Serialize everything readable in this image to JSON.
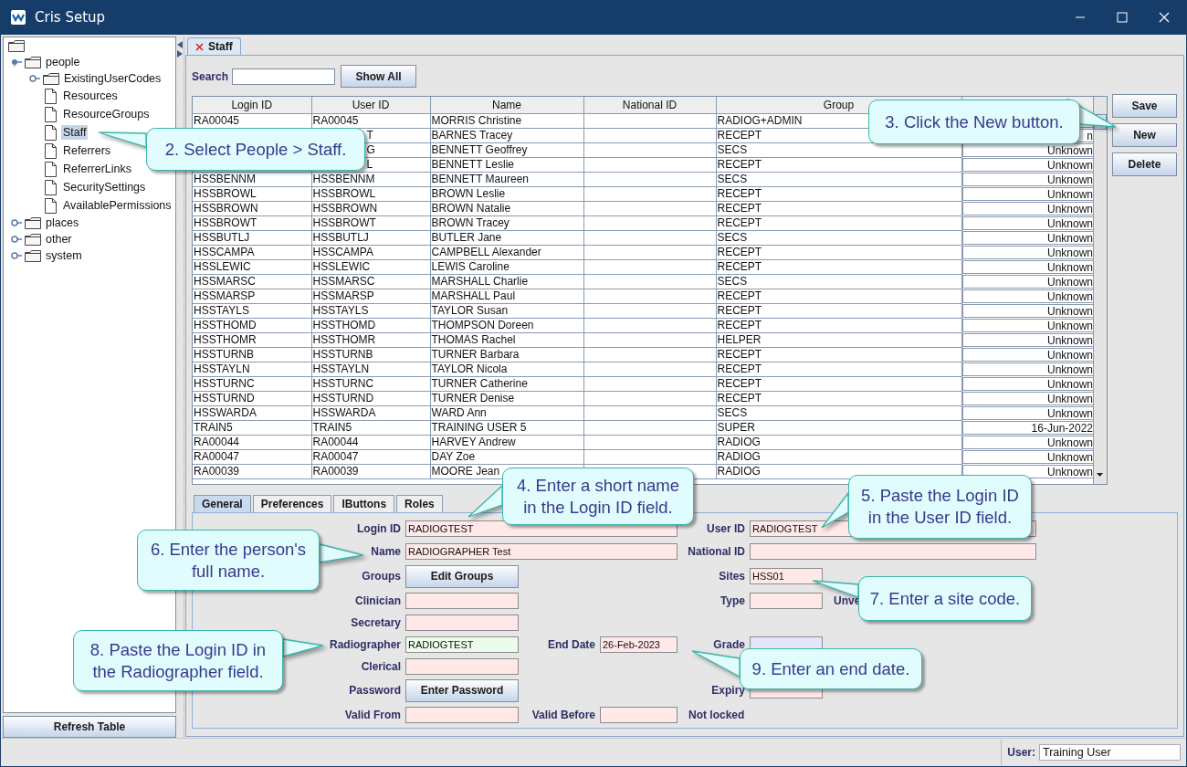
{
  "window": {
    "title": "Cris Setup"
  },
  "tree": {
    "kind": "folder",
    "children": [
      {
        "label": "people",
        "kind": "folder",
        "expanded": true,
        "selected": false,
        "children": [
          {
            "label": "ExistingUserCodes",
            "kind": "folder",
            "expanded": false,
            "selected": false
          },
          {
            "label": "Resources",
            "kind": "page",
            "selected": false
          },
          {
            "label": "ResourceGroups",
            "kind": "page",
            "selected": false
          },
          {
            "label": "Staff",
            "kind": "page",
            "selected": true
          },
          {
            "label": "Referrers",
            "kind": "page",
            "selected": false
          },
          {
            "label": "ReferrerLinks",
            "kind": "page",
            "selected": false
          },
          {
            "label": "SecuritySettings",
            "kind": "page",
            "selected": false
          },
          {
            "label": "AvailablePermissions",
            "kind": "page",
            "selected": false
          }
        ]
      },
      {
        "label": "places",
        "kind": "folder",
        "expanded": false,
        "selected": false
      },
      {
        "label": "other",
        "kind": "folder",
        "expanded": false,
        "selected": false
      },
      {
        "label": "system",
        "kind": "folder",
        "expanded": false,
        "selected": false
      }
    ]
  },
  "refresh_button": "Refresh Table",
  "tab": {
    "label": "Staff"
  },
  "search": {
    "label": "Search",
    "button": "Show All"
  },
  "table": {
    "columns": [
      "Login ID",
      "User ID",
      "Name",
      "National ID",
      "Group",
      null
    ],
    "rows": [
      [
        "RA00045",
        "RA00045",
        "MORRIS Christine",
        null,
        "RADIOG+ADMIN",
        null
      ],
      [
        null,
        {
          "text": "T",
          "covered": true
        },
        "BARNES Tracey",
        null,
        "RECEPT",
        "n"
      ],
      [
        null,
        {
          "text": "G",
          "covered": true
        },
        "BENNETT Geoffrey",
        null,
        "SECS",
        "Unknown"
      ],
      [
        null,
        {
          "text": "L",
          "covered": true
        },
        "BENNETT Leslie",
        null,
        "RECEPT",
        "Unknown"
      ],
      [
        "HSSBENNM",
        "HSSBENNM",
        "BENNETT Maureen",
        null,
        "SECS",
        "Unknown"
      ],
      [
        "HSSBROWL",
        "HSSBROWL",
        "BROWN Leslie",
        null,
        "RECEPT",
        "Unknown"
      ],
      [
        "HSSBROWN",
        "HSSBROWN",
        "BROWN Natalie",
        null,
        "RECEPT",
        "Unknown"
      ],
      [
        "HSSBROWT",
        "HSSBROWT",
        "BROWN Tracey",
        null,
        "RECEPT",
        "Unknown"
      ],
      [
        "HSSBUTLJ",
        "HSSBUTLJ",
        "BUTLER Jane",
        null,
        "SECS",
        "Unknown"
      ],
      [
        "HSSCAMPA",
        "HSSCAMPA",
        "CAMPBELL Alexander",
        null,
        "RECEPT",
        "Unknown"
      ],
      [
        "HSSLEWIC",
        "HSSLEWIC",
        "LEWIS Caroline",
        null,
        "RECEPT",
        "Unknown"
      ],
      [
        "HSSMARSC",
        "HSSMARSC",
        "MARSHALL Charlie",
        null,
        "SECS",
        "Unknown"
      ],
      [
        "HSSMARSP",
        "HSSMARSP",
        "MARSHALL Paul",
        null,
        "RECEPT",
        "Unknown"
      ],
      [
        "HSSTAYLS",
        "HSSTAYLS",
        "TAYLOR Susan",
        null,
        "RECEPT",
        "Unknown"
      ],
      [
        "HSSTHOMD",
        "HSSTHOMD",
        "THOMPSON Doreen",
        null,
        "RECEPT",
        "Unknown"
      ],
      [
        "HSSTHOMR",
        "HSSTHOMR",
        "THOMAS Rachel",
        null,
        "HELPER",
        "Unknown"
      ],
      [
        "HSSTURNB",
        "HSSTURNB",
        "TURNER Barbara",
        null,
        "RECEPT",
        "Unknown"
      ],
      [
        "HSSTAYLN",
        "HSSTAYLN",
        "TAYLOR Nicola",
        null,
        "RECEPT",
        "Unknown"
      ],
      [
        "HSSTURNC",
        "HSSTURNC",
        "TURNER Catherine",
        null,
        "RECEPT",
        "Unknown"
      ],
      [
        "HSSTURND",
        "HSSTURND",
        "TURNER Denise",
        null,
        "RECEPT",
        "Unknown"
      ],
      [
        "HSSWARDA",
        "HSSWARDA",
        "WARD Ann",
        null,
        "SECS",
        "Unknown"
      ],
      [
        "TRAIN5",
        "TRAIN5",
        "TRAINING USER 5",
        null,
        "SUPER",
        "16-Jun-2022"
      ],
      [
        "RA00044",
        "RA00044",
        "HARVEY Andrew",
        null,
        "RADIOG",
        "Unknown"
      ],
      [
        "RA00047",
        "RA00047",
        "DAY Zoe",
        null,
        "RADIOG",
        "Unknown"
      ],
      [
        "RA00039",
        "RA00039",
        "MOORE Jean",
        null,
        "RADIOG",
        "Unknown"
      ]
    ]
  },
  "actions": [
    "Save",
    "New",
    "Delete"
  ],
  "form_tabs": [
    {
      "label": "General",
      "selected": true
    },
    {
      "label": "Preferences",
      "selected": false
    },
    {
      "label": "IButtons",
      "selected": false
    },
    {
      "label": "Roles",
      "selected": false
    }
  ],
  "form": {
    "rows": [
      [
        {
          "kind": "field",
          "label": "Login ID",
          "value": "RADIOGTEST",
          "color": "#ffe8e8"
        },
        {
          "kind": "field",
          "label": "User ID",
          "value": "RADIOGTEST",
          "color": "#ffe8e8"
        }
      ],
      [
        {
          "kind": "field",
          "label": "Name",
          "value": "RADIOGRAPHER Test",
          "color": "#ffe8e8"
        },
        {
          "kind": "field",
          "label": "National ID",
          "color": "#ffe8e8"
        }
      ],
      [
        {
          "kind": "button",
          "label": "Groups",
          "value": "Edit Groups"
        },
        {
          "kind": "field",
          "label": "Sites",
          "value": "HSS01",
          "color": "#ffe8e8"
        }
      ],
      [
        {
          "kind": "field",
          "label": "Clinician",
          "color": "#ffe8e8"
        },
        {
          "kind": "field",
          "label": "Type",
          "color": "#ffe8e8"
        },
        {
          "kind": "note",
          "value": "Unve"
        }
      ],
      [
        {
          "kind": "field",
          "label": "Secretary",
          "color": "#ffe8e8"
        }
      ],
      [
        {
          "kind": "field",
          "label": "Radiographer",
          "value": "RADIOGTEST",
          "color": "#ecfcec"
        },
        {
          "kind": "field",
          "label": "End Date",
          "value": "26-Feb-2023",
          "color": "#ffe8e8"
        },
        {
          "kind": "field",
          "label": "Grade",
          "color": "#e6e6fa"
        }
      ],
      [
        {
          "kind": "field",
          "label": "Clerical",
          "color": "#ffe8e8"
        }
      ],
      [
        {
          "kind": "button",
          "label": "Password",
          "value": "Enter Password"
        },
        {
          "kind": "field",
          "label": "Expiry",
          "color": "#ffe8e8"
        }
      ],
      [
        {
          "kind": "field",
          "label": "Valid From",
          "color": "#ffe8e8"
        },
        {
          "kind": "field",
          "label": "Valid Before",
          "color": "#ffe8e8"
        },
        {
          "kind": "note",
          "value": "Not locked"
        }
      ]
    ]
  },
  "status_bar": {
    "label": "User:",
    "value": "Training User"
  },
  "callouts": [
    {
      "text": "2. Select People > Staff."
    },
    {
      "text": "3. Click the New button."
    },
    {
      "text": "4. Enter a short name\nin the Login ID field."
    },
    {
      "text": "5. Paste the Login ID\nin the User ID field."
    },
    {
      "text": "6. Enter the person's\nfull name."
    },
    {
      "text": "7. Enter a site code."
    },
    {
      "text": "8. Paste the Login ID in\nthe Radiographer field."
    },
    {
      "text": "9. Enter an end date."
    }
  ]
}
